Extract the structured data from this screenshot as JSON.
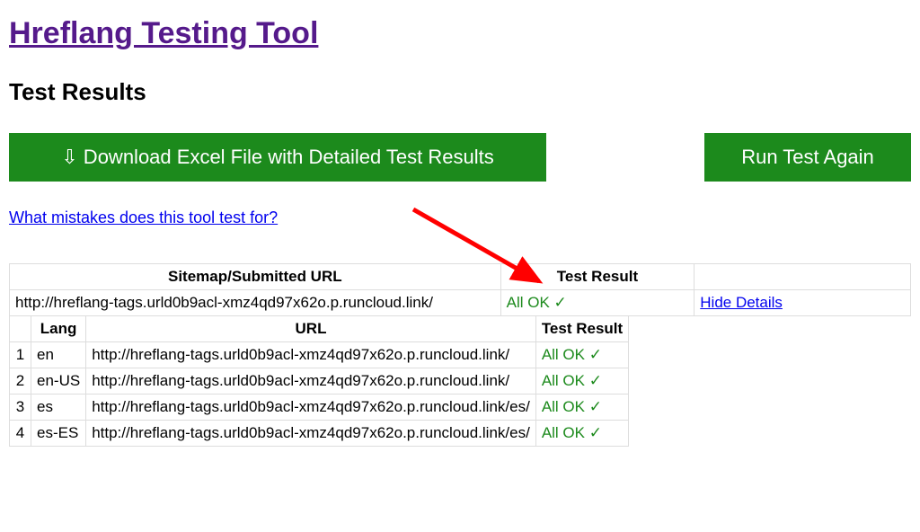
{
  "header": {
    "title": "Hreflang Testing Tool",
    "section": "Test Results"
  },
  "buttons": {
    "download": "⇩ Download Excel File with Detailed Test Results",
    "run_again": "Run Test Again"
  },
  "links": {
    "help": "What mistakes does this tool test for?",
    "hide_details": "Hide Details"
  },
  "outer_table": {
    "headers": {
      "url": "Sitemap/Submitted URL",
      "result": "Test Result"
    },
    "row": {
      "url": "http://hreflang-tags.urld0b9acl-xmz4qd97x62o.p.runcloud.link/",
      "result": "All OK",
      "check": "✓"
    }
  },
  "inner_table": {
    "headers": {
      "lang": "Lang",
      "url": "URL",
      "result": "Test Result"
    },
    "rows": [
      {
        "idx": "1",
        "lang": "en",
        "url": "http://hreflang-tags.urld0b9acl-xmz4qd97x62o.p.runcloud.link/",
        "result": "All OK",
        "check": "✓"
      },
      {
        "idx": "2",
        "lang": "en-US",
        "url": "http://hreflang-tags.urld0b9acl-xmz4qd97x62o.p.runcloud.link/",
        "result": "All OK",
        "check": "✓"
      },
      {
        "idx": "3",
        "lang": "es",
        "url": "http://hreflang-tags.urld0b9acl-xmz4qd97x62o.p.runcloud.link/es/",
        "result": "All OK",
        "check": "✓"
      },
      {
        "idx": "4",
        "lang": "es-ES",
        "url": "http://hreflang-tags.urld0b9acl-xmz4qd97x62o.p.runcloud.link/es/",
        "result": "All OK",
        "check": "✓"
      }
    ]
  }
}
